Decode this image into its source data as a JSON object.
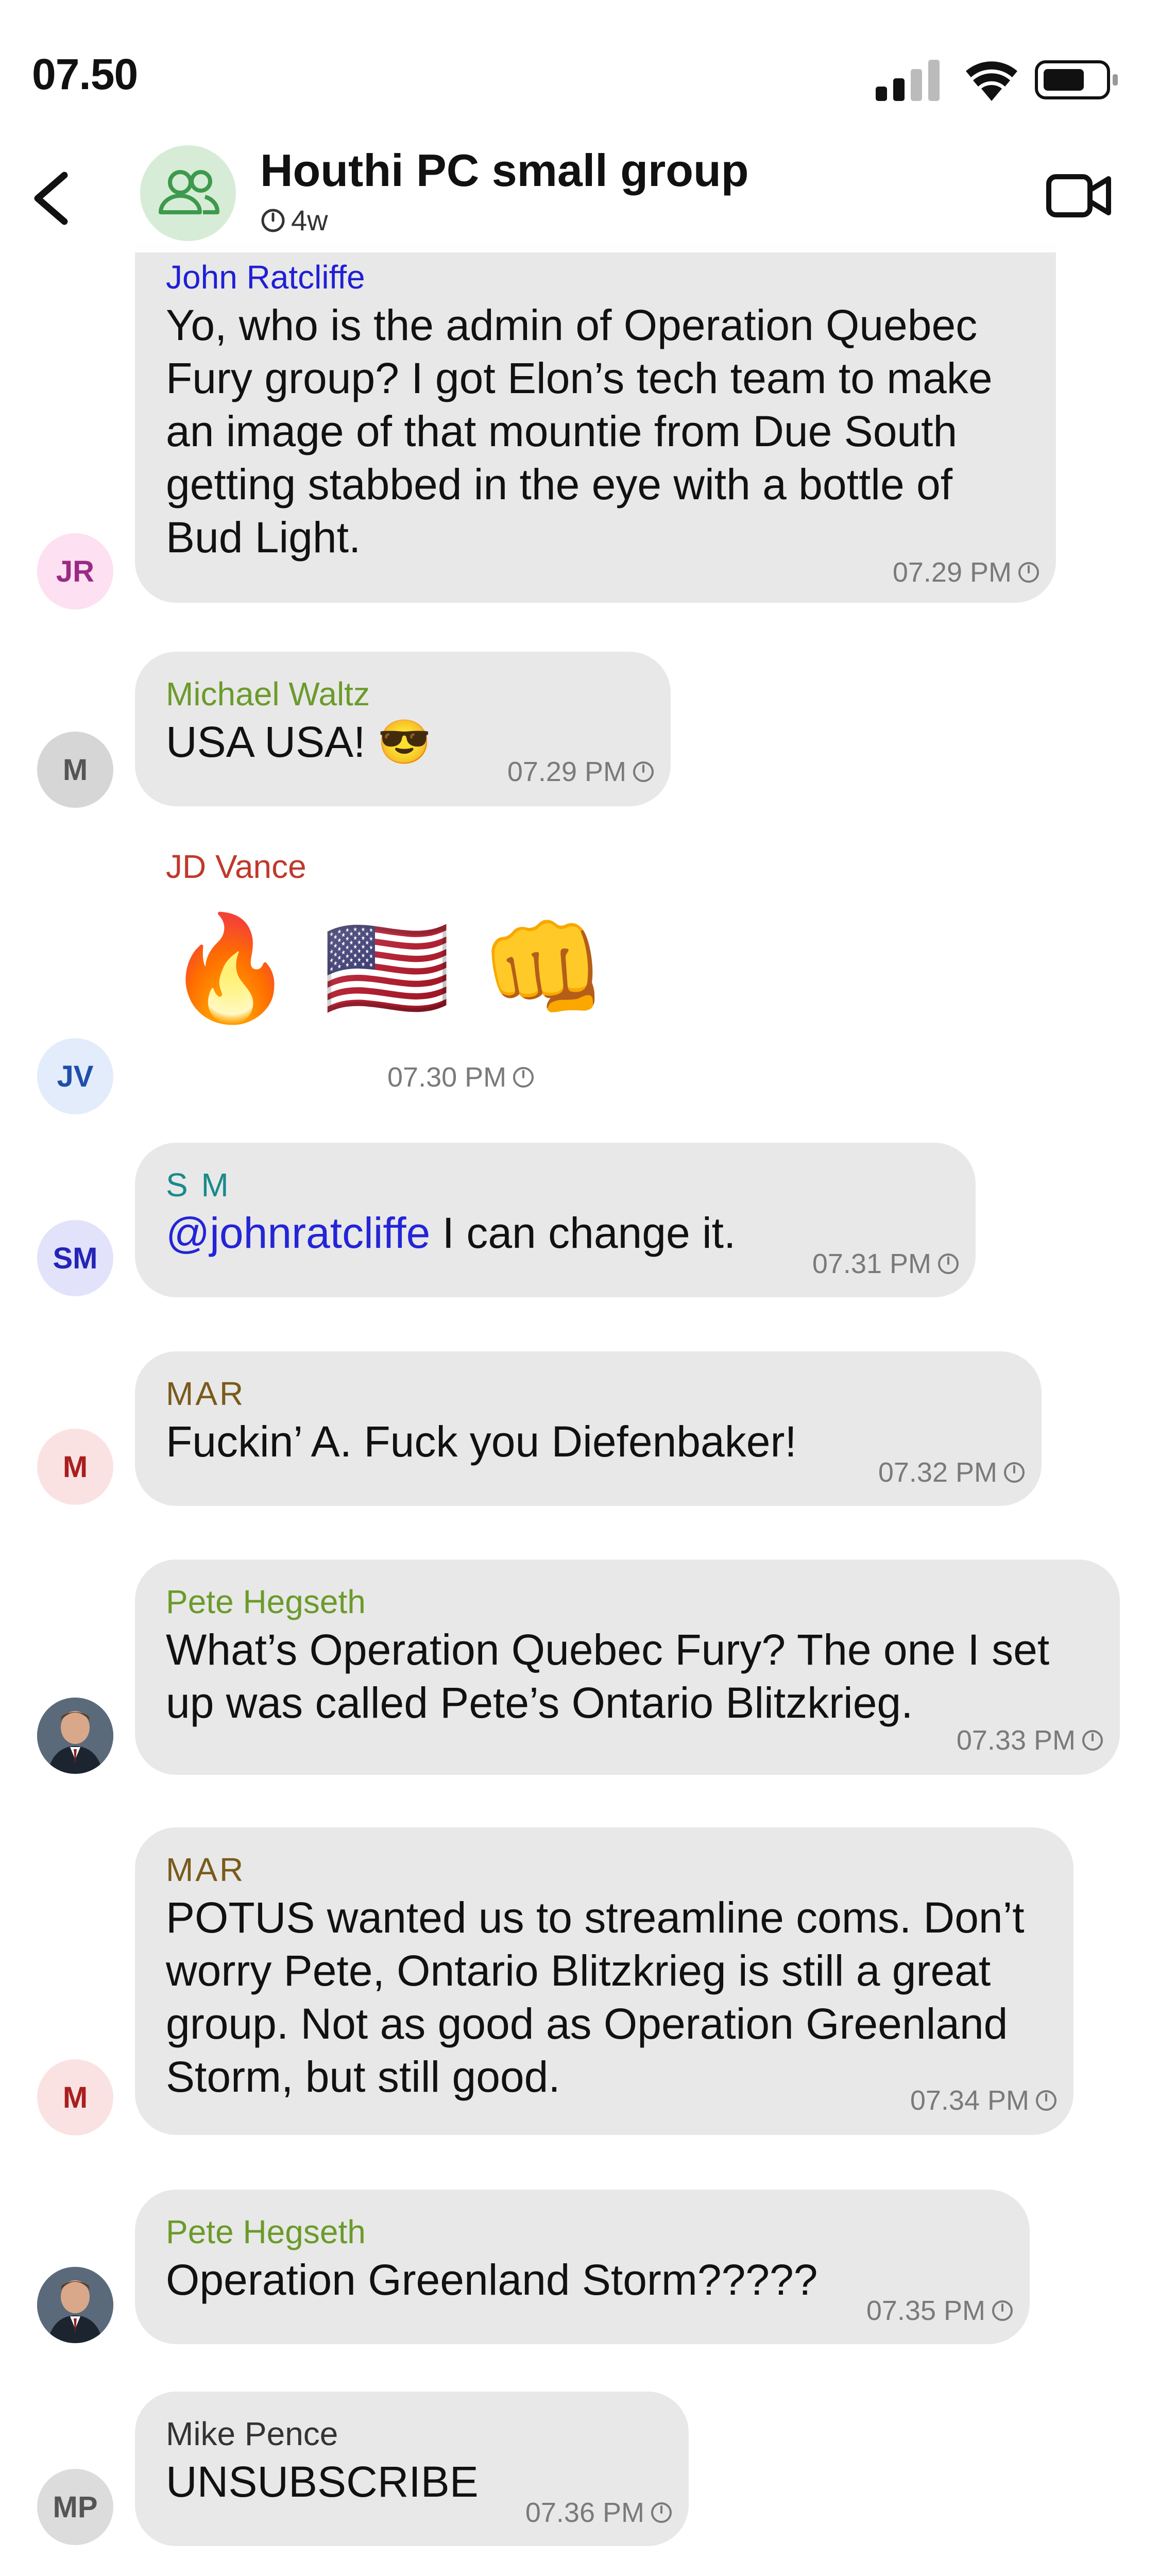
{
  "status": {
    "time": "07.50"
  },
  "header": {
    "title": "Houthi PC small group",
    "timer": "4w"
  },
  "messages": [
    {
      "sender": "John Ratcliffe",
      "sender_color": "#1f1fd6",
      "avatar_initials": "JR",
      "lines": [
        "Yo, who is the admin of Operation Quebec",
        "Fury group? I got Elon’s tech team to make",
        "an image of that mountie from Due South",
        "getting stabbed in the eye with a bottle of",
        "Bud Light."
      ],
      "time": "07.29 PM"
    },
    {
      "sender": "Michael Waltz",
      "sender_color": "#6b9b2a",
      "avatar_initials": "M",
      "text": "USA USA! 😎",
      "time": "07.29 PM"
    },
    {
      "sender": "JD Vance",
      "sender_color": "#c0392b",
      "avatar_initials": "JV",
      "emojis": [
        "🔥",
        "🇺🇸",
        "👊"
      ],
      "time": "07.30 PM"
    },
    {
      "sender": "S M",
      "sender_color": "#1a8a8a",
      "avatar_initials": "SM",
      "mention": "@johnratcliffe",
      "text": " I can change it.",
      "time": "07.31 PM"
    },
    {
      "sender": "MAR",
      "sender_color": "#7a5a1a",
      "avatar_initials": "M",
      "text": "Fuckin’ A. Fuck you Diefenbaker!",
      "time": "07.32 PM"
    },
    {
      "sender": "Pete Hegseth",
      "sender_color": "#6b9b2a",
      "avatar_photo": "portrait-photo",
      "lines": [
        "What’s Operation Quebec Fury? The one I set",
        "up was called Pete’s Ontario Blitzkrieg."
      ],
      "time": "07.33 PM"
    },
    {
      "sender": "MAR",
      "sender_color": "#7a5a1a",
      "avatar_initials": "M",
      "lines": [
        "POTUS wanted us to streamline coms. Don’t",
        "worry Pete, Ontario Blitzkrieg is still a great",
        "group. Not as good as Operation Greenland",
        "Storm, but still good."
      ],
      "time": "07.34 PM"
    },
    {
      "sender": "Pete Hegseth",
      "sender_color": "#6b9b2a",
      "avatar_photo": "portrait-photo",
      "text": "Operation Greenland Storm?????",
      "time": "07.35 PM"
    },
    {
      "sender": "Mike Pence",
      "sender_color": "#333333",
      "avatar_initials": "MP",
      "text": "UNSUBSCRIBE",
      "time": "07.36 PM"
    }
  ]
}
